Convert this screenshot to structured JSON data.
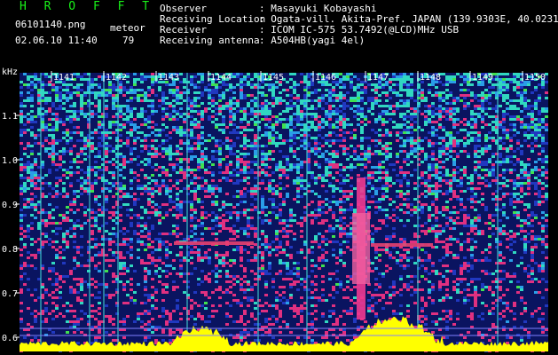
{
  "header": {
    "title": "H R O F F T",
    "filename": "06101140.png",
    "mode_label": "meteor",
    "datetime": "02.06.10 11:40",
    "count": "79",
    "observer_label": "Observer",
    "observer_value": ": Masayuki Kobayashi",
    "location_label": "Receiving Location",
    "location_value": ": Ogata-vill. Akita-Pref. JAPAN (139.9303E, 40.0231N)",
    "receiver_label": "Receiver",
    "receiver_value": ": ICOM IC-575 53.7492(@LCD)MHz USB",
    "antenna_label": "Receiving antenna",
    "antenna_value": ": A504HB(yagi 4el)"
  },
  "axis": {
    "unit": "kHz",
    "y_ticks": [
      "1.1",
      "1.0",
      "0.9",
      "0.8",
      "0.7",
      "0.6"
    ],
    "time_ticks": [
      "1141",
      "1142",
      "1143",
      "1144",
      "1145",
      "1146",
      "1147",
      "1148",
      "1149",
      "1150"
    ]
  },
  "colors": {
    "background": "#000000",
    "title_green": "#19f219",
    "text": "#ffffff",
    "spectrum_yellow": "#ffff00",
    "noise_low": "#1a2fa8",
    "noise_mid": "#2fd4c8",
    "noise_high": "#f03090"
  }
}
